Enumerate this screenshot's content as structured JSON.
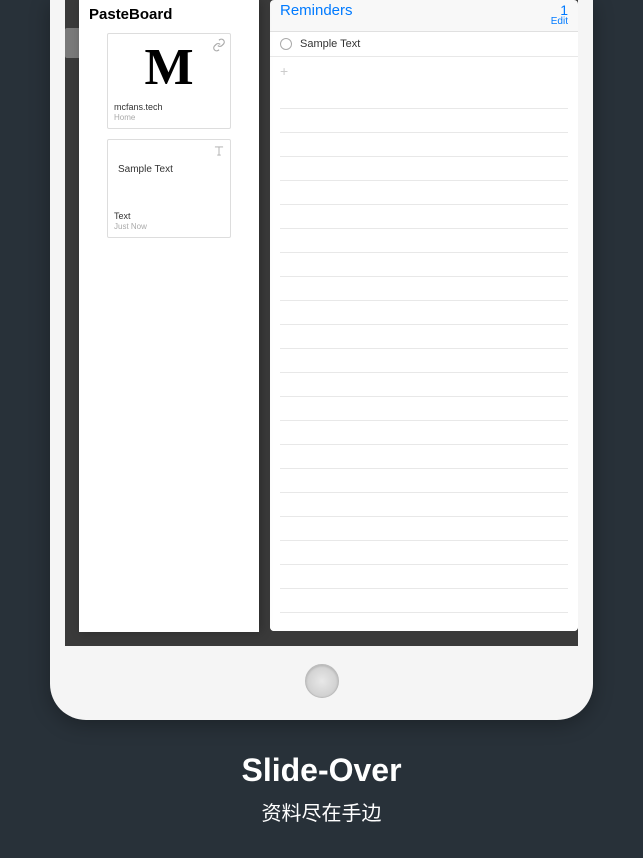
{
  "pasteboard": {
    "title": "PasteBoard",
    "clips": [
      {
        "preview": "M",
        "label": "mcfans.tech",
        "sub": "Home",
        "type": "link"
      },
      {
        "preview": "Sample Text",
        "label": "Text",
        "sub": "Just Now",
        "type": "text"
      }
    ]
  },
  "reminders": {
    "title": "Reminders",
    "count": "1",
    "edit": "Edit",
    "items": [
      {
        "text": "Sample Text"
      }
    ],
    "add_symbol": "+"
  },
  "caption": {
    "title": "Slide-Over",
    "subtitle": "资料尽在手边"
  }
}
